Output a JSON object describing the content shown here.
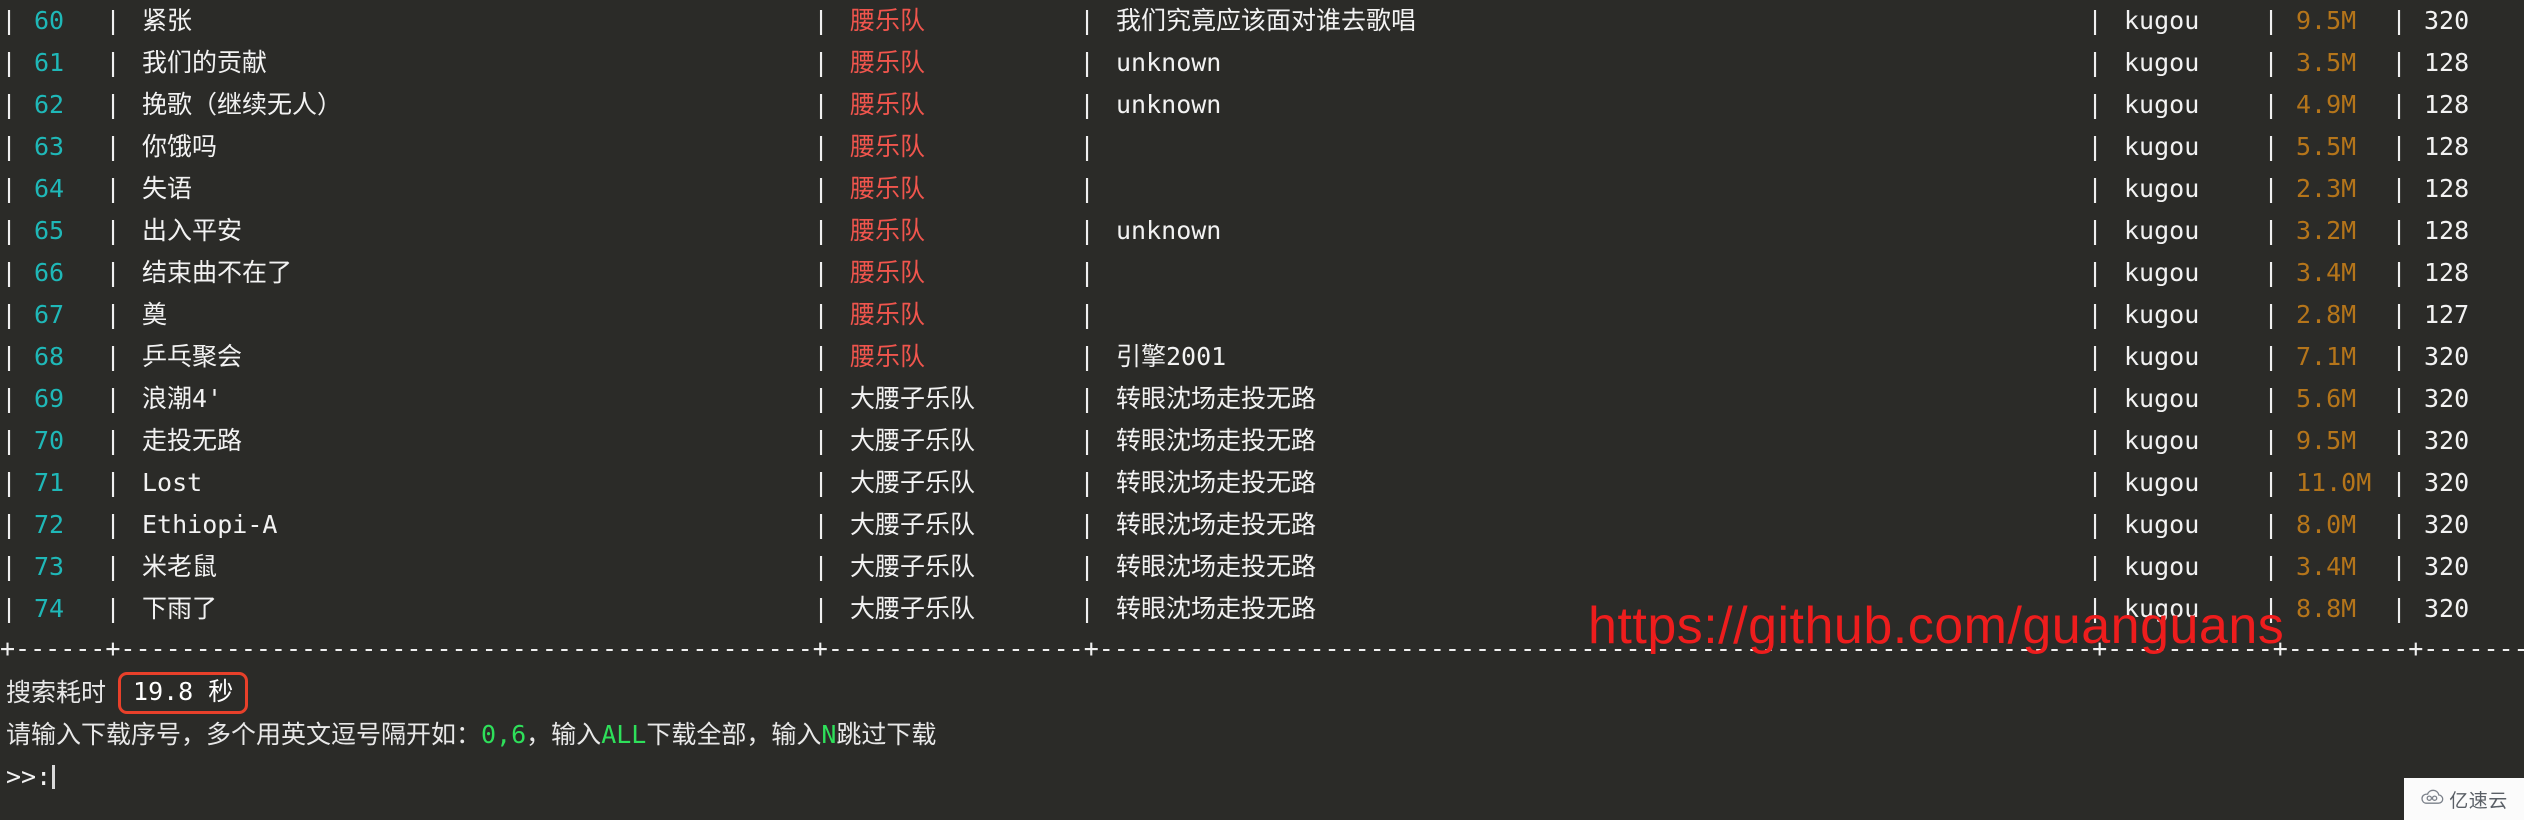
{
  "terminal": {
    "background_color": "#2b2b28",
    "index_color": "#1fb8b8",
    "artist_highlight_color": "#f0554d",
    "size_color": "#b5751a",
    "accent_green": "#2ee05a",
    "accent_red": "#e8402a"
  },
  "table": {
    "separator_char": "|",
    "rows": [
      {
        "index": "60",
        "song": "紧张",
        "artist": "腰乐队",
        "artist_red": true,
        "album": "我们究竟应该面对谁去歌唱",
        "source": "kugou",
        "size": "9.5M",
        "rate": "320"
      },
      {
        "index": "61",
        "song": "我们的贡献",
        "artist": "腰乐队",
        "artist_red": true,
        "album": "unknown",
        "source": "kugou",
        "size": "3.5M",
        "rate": "128"
      },
      {
        "index": "62",
        "song": "挽歌（继续无人）",
        "artist": "腰乐队",
        "artist_red": true,
        "album": "unknown",
        "source": "kugou",
        "size": "4.9M",
        "rate": "128"
      },
      {
        "index": "63",
        "song": "你饿吗",
        "artist": "腰乐队",
        "artist_red": true,
        "album": "",
        "source": "kugou",
        "size": "5.5M",
        "rate": "128"
      },
      {
        "index": "64",
        "song": "失语",
        "artist": "腰乐队",
        "artist_red": true,
        "album": "",
        "source": "kugou",
        "size": "2.3M",
        "rate": "128"
      },
      {
        "index": "65",
        "song": "出入平安",
        "artist": "腰乐队",
        "artist_red": true,
        "album": "unknown",
        "source": "kugou",
        "size": "3.2M",
        "rate": "128"
      },
      {
        "index": "66",
        "song": "结束曲不在了",
        "artist": "腰乐队",
        "artist_red": true,
        "album": "",
        "source": "kugou",
        "size": "3.4M",
        "rate": "128"
      },
      {
        "index": "67",
        "song": "奠",
        "artist": "腰乐队",
        "artist_red": true,
        "album": "",
        "source": "kugou",
        "size": "2.8M",
        "rate": "127"
      },
      {
        "index": "68",
        "song": "乒乓聚会",
        "artist": "腰乐队",
        "artist_red": true,
        "album": "引擎2001",
        "source": "kugou",
        "size": "7.1M",
        "rate": "320"
      },
      {
        "index": "69",
        "song": "浪潮4'",
        "artist": "大腰子乐队",
        "artist_red": false,
        "album": "转眼沈场走投无路",
        "source": "kugou",
        "size": "5.6M",
        "rate": "320"
      },
      {
        "index": "70",
        "song": "走投无路",
        "artist": "大腰子乐队",
        "artist_red": false,
        "album": "转眼沈场走投无路",
        "source": "kugou",
        "size": "9.5M",
        "rate": "320"
      },
      {
        "index": "71",
        "song": "Lost",
        "artist": "大腰子乐队",
        "artist_red": false,
        "album": "转眼沈场走投无路",
        "source": "kugou",
        "size": "11.0M",
        "rate": "320"
      },
      {
        "index": "72",
        "song": "Ethiopi-A",
        "artist": "大腰子乐队",
        "artist_red": false,
        "album": "转眼沈场走投无路",
        "source": "kugou",
        "size": "8.0M",
        "rate": "320"
      },
      {
        "index": "73",
        "song": "米老鼠",
        "artist": "大腰子乐队",
        "artist_red": false,
        "album": "转眼沈场走投无路",
        "source": "kugou",
        "size": "3.4M",
        "rate": "320"
      },
      {
        "index": "74",
        "song": "下雨了",
        "artist": "大腰子乐队",
        "artist_red": false,
        "album": "转眼沈场走投无路",
        "source": "kugou",
        "size": "8.8M",
        "rate": "320"
      }
    ]
  },
  "footer": {
    "elapsed_label": "搜索耗时",
    "elapsed_value": "19.8 秒",
    "instruction_prefix": "请输入下载序号，多个用英文逗号隔开如：",
    "instruction_example": "0,6",
    "instruction_mid1": "，输入",
    "instruction_all": "ALL",
    "instruction_mid2": "下载全部，输入",
    "instruction_skip": "N",
    "instruction_suffix": "跳过下载",
    "prompt_symbol": ">>:"
  },
  "watermark": {
    "url": "https://github.com/guanguans",
    "badge_text": "亿速云",
    "badge_icon": "cloud-icon"
  }
}
